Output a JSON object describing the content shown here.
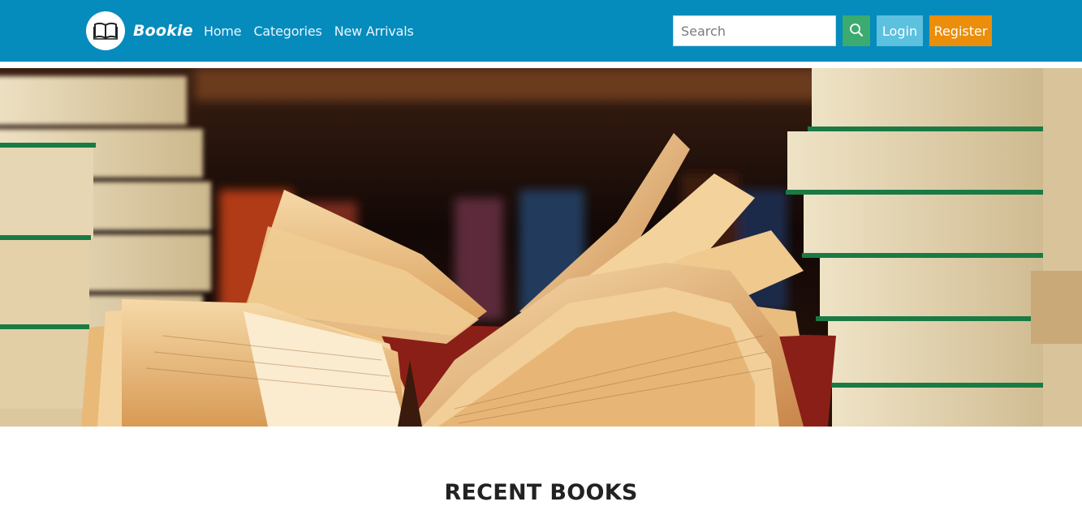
{
  "brand": {
    "name": "Bookie",
    "logo_icon": "open-book-icon"
  },
  "nav": {
    "links": [
      "Home",
      "Categories",
      "New Arrivals"
    ]
  },
  "search": {
    "placeholder": "Search",
    "button_icon": "search-icon"
  },
  "auth": {
    "login_label": "Login",
    "register_label": "Register"
  },
  "hero": {
    "image_subject": "open-books-image"
  },
  "section": {
    "title": "RECENT BOOKS"
  },
  "colors": {
    "navbar": "#068bbd",
    "search_button": "#3bab6f",
    "login_button": "#5cc0df",
    "register_button": "#eb8e0b"
  }
}
